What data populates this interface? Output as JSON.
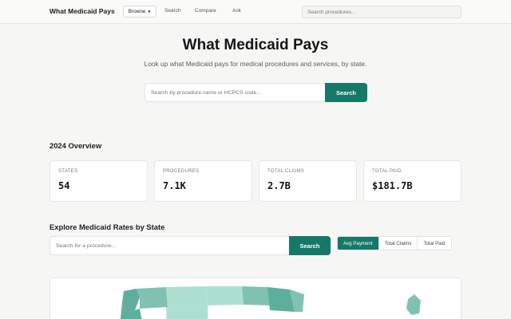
{
  "nav": {
    "brand": "What Medicaid Pays",
    "browse_label": "Browse",
    "links": [
      "Search",
      "Compare",
      "Ask"
    ],
    "search_placeholder": "Search procedures..."
  },
  "hero": {
    "title": "What Medicaid Pays",
    "subtitle": "Look up what Medicaid pays for medical procedures and services, by state.",
    "search_placeholder": "Search by procedure name or HCPCS code...",
    "search_button": "Search"
  },
  "overview": {
    "title": "2024 Overview",
    "stats": [
      {
        "label": "STATES",
        "value": "54"
      },
      {
        "label": "PROCEDURES",
        "value": "7.1K"
      },
      {
        "label": "TOTAL CLAIMS",
        "value": "2.7B"
      },
      {
        "label": "TOTAL PAID",
        "value": "$181.7B"
      }
    ]
  },
  "explore": {
    "title": "Explore Medicaid Rates by State",
    "search_placeholder": "Search for a procedure...",
    "search_button": "Search",
    "metric_options": [
      "Avg Payment",
      "Total Claims",
      "Total Paid"
    ],
    "selected_metric": "Avg Payment"
  },
  "colors": {
    "accent": "#15796a",
    "map_dark": "#5fae9d",
    "map_mid": "#7fc2b2",
    "map_light": "#aee0d1"
  }
}
